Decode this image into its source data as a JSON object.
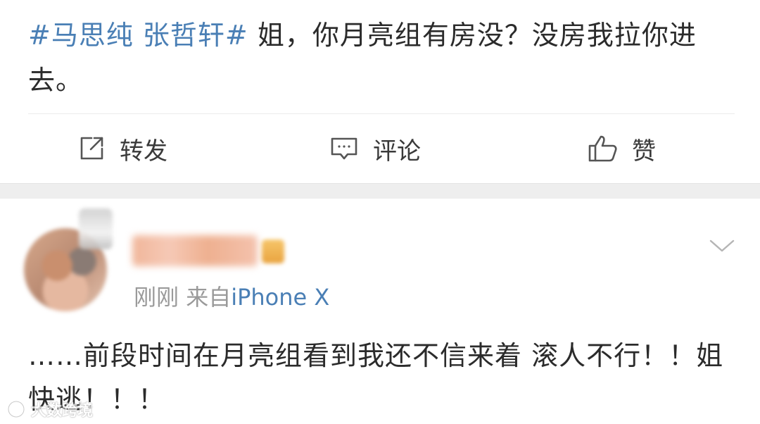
{
  "post": {
    "hashtag": "#马思纯 张哲轩#",
    "body": " 姐，你月亮组有房没？没房我拉你进去。"
  },
  "actions": {
    "repost": {
      "label": "转发",
      "icon": "share-square-icon"
    },
    "comment": {
      "label": "评论",
      "icon": "comment-bubble-icon"
    },
    "like": {
      "label": "赞",
      "icon": "thumbs-up-icon"
    }
  },
  "comment": {
    "time": "刚刚",
    "source_prefix": "来自",
    "source": "iPhone X",
    "text": "……前段时间在月亮组看到我还不信来着 滚人不行！！姐快逃！！！"
  },
  "watermark": {
    "text": "大数跨境"
  },
  "colors": {
    "link": "#4a7fb5",
    "text": "#2b2b2b",
    "meta": "#9a9a9a",
    "separator": "#eeeeee"
  }
}
